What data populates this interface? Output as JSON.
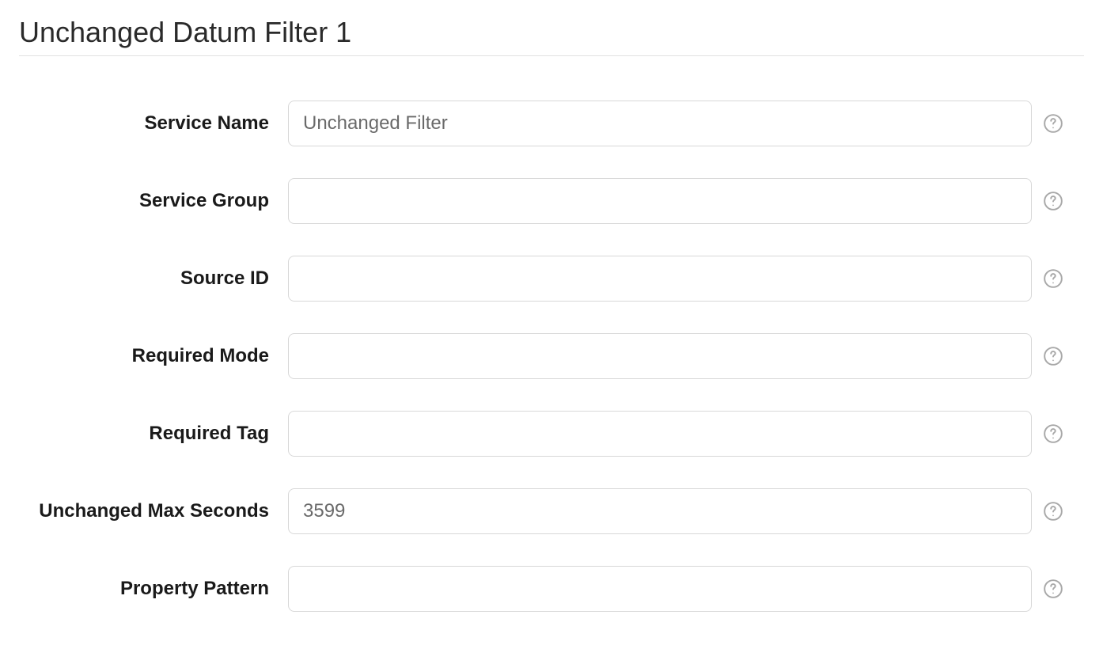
{
  "form": {
    "title": "Unchanged Datum Filter 1",
    "fields": {
      "service_name": {
        "label": "Service Name",
        "placeholder": "Unchanged Filter",
        "value": ""
      },
      "service_group": {
        "label": "Service Group",
        "placeholder": "",
        "value": ""
      },
      "source_id": {
        "label": "Source ID",
        "placeholder": "",
        "value": ""
      },
      "required_mode": {
        "label": "Required Mode",
        "placeholder": "",
        "value": ""
      },
      "required_tag": {
        "label": "Required Tag",
        "placeholder": "",
        "value": ""
      },
      "unchanged_max_seconds": {
        "label": "Unchanged Max Seconds",
        "placeholder": "3599",
        "value": ""
      },
      "property_pattern": {
        "label": "Property Pattern",
        "placeholder": "",
        "value": ""
      }
    }
  }
}
